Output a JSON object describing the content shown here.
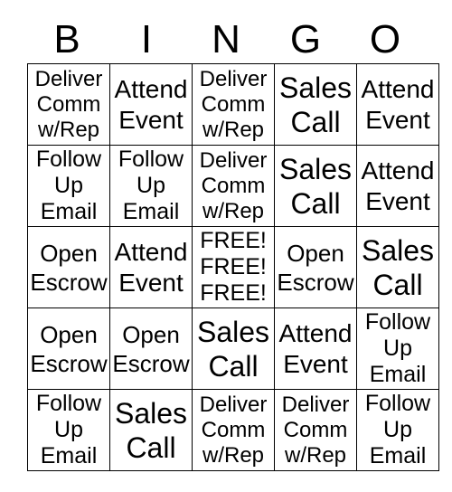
{
  "card": {
    "header_letters": [
      "B",
      "I",
      "N",
      "G",
      "O"
    ],
    "grid": {
      "columns": 5,
      "rows": 5,
      "cells": [
        {
          "text": "Deliver\nComm\nw/Rep",
          "style": "size-3line"
        },
        {
          "text": "Attend\nEvent",
          "style": "size-2line-mid"
        },
        {
          "text": "Deliver\nComm\nw/Rep",
          "style": "size-3line"
        },
        {
          "text": "Sales\nCall",
          "style": "size-2line-big"
        },
        {
          "text": "Attend\nEvent",
          "style": "size-2line-mid"
        },
        {
          "text": "Follow\nUp\nEmail",
          "style": "size-3line-follow"
        },
        {
          "text": "Follow\nUp\nEmail",
          "style": "size-3line-follow"
        },
        {
          "text": "Deliver\nComm\nw/Rep",
          "style": "size-3line"
        },
        {
          "text": "Sales\nCall",
          "style": "size-2line-big"
        },
        {
          "text": "Attend\nEvent",
          "style": "size-2line-mid"
        },
        {
          "text": "Open\nEscrow",
          "style": "size-2line-small"
        },
        {
          "text": "Attend\nEvent",
          "style": "size-2line-mid"
        },
        {
          "text": "FREE!\nFREE!\nFREE!",
          "style": "size-3line-free"
        },
        {
          "text": "Open\nEscrow",
          "style": "size-2line-small"
        },
        {
          "text": "Sales\nCall",
          "style": "size-2line-big"
        },
        {
          "text": "Open\nEscrow",
          "style": "size-2line-small"
        },
        {
          "text": "Open\nEscrow",
          "style": "size-2line-small"
        },
        {
          "text": "Sales\nCall",
          "style": "size-2line-big"
        },
        {
          "text": "Attend\nEvent",
          "style": "size-2line-mid"
        },
        {
          "text": "Follow\nUp\nEmail",
          "style": "size-3line-follow"
        },
        {
          "text": "Follow\nUp\nEmail",
          "style": "size-3line-follow"
        },
        {
          "text": "Sales\nCall",
          "style": "size-2line-big"
        },
        {
          "text": "Deliver\nComm\nw/Rep",
          "style": "size-3line"
        },
        {
          "text": "Deliver\nComm\nw/Rep",
          "style": "size-3line"
        },
        {
          "text": "Follow\nUp\nEmail",
          "style": "size-3line-follow"
        }
      ]
    },
    "colors": {
      "background": "#ffffff",
      "text": "#000000",
      "border": "#000000"
    }
  }
}
